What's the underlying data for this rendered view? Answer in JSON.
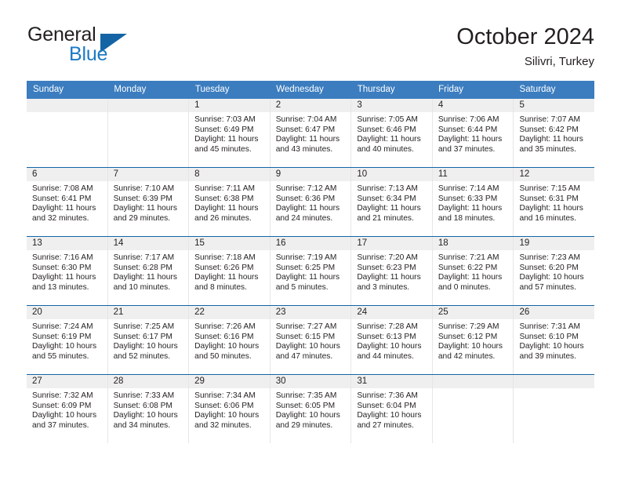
{
  "brand": {
    "name_part1": "General",
    "name_part2": "Blue",
    "logo_icon": "triangle-logo",
    "accent_color": "#1d7ac4",
    "triangle_color": "#1464a5"
  },
  "header": {
    "title": "October 2024",
    "subtitle": "Silivri, Turkey"
  },
  "calendar": {
    "header_bg": "#3b7dbf",
    "daynum_bg": "#efefef",
    "week_divider_color": "#1464a5",
    "weekdays": [
      "Sunday",
      "Monday",
      "Tuesday",
      "Wednesday",
      "Thursday",
      "Friday",
      "Saturday"
    ],
    "weeks": [
      [
        {
          "day": "",
          "sunrise": "",
          "sunset": "",
          "daylight1": "",
          "daylight2": ""
        },
        {
          "day": "",
          "sunrise": "",
          "sunset": "",
          "daylight1": "",
          "daylight2": ""
        },
        {
          "day": "1",
          "sunrise": "Sunrise: 7:03 AM",
          "sunset": "Sunset: 6:49 PM",
          "daylight1": "Daylight: 11 hours",
          "daylight2": "and 45 minutes."
        },
        {
          "day": "2",
          "sunrise": "Sunrise: 7:04 AM",
          "sunset": "Sunset: 6:47 PM",
          "daylight1": "Daylight: 11 hours",
          "daylight2": "and 43 minutes."
        },
        {
          "day": "3",
          "sunrise": "Sunrise: 7:05 AM",
          "sunset": "Sunset: 6:46 PM",
          "daylight1": "Daylight: 11 hours",
          "daylight2": "and 40 minutes."
        },
        {
          "day": "4",
          "sunrise": "Sunrise: 7:06 AM",
          "sunset": "Sunset: 6:44 PM",
          "daylight1": "Daylight: 11 hours",
          "daylight2": "and 37 minutes."
        },
        {
          "day": "5",
          "sunrise": "Sunrise: 7:07 AM",
          "sunset": "Sunset: 6:42 PM",
          "daylight1": "Daylight: 11 hours",
          "daylight2": "and 35 minutes."
        }
      ],
      [
        {
          "day": "6",
          "sunrise": "Sunrise: 7:08 AM",
          "sunset": "Sunset: 6:41 PM",
          "daylight1": "Daylight: 11 hours",
          "daylight2": "and 32 minutes."
        },
        {
          "day": "7",
          "sunrise": "Sunrise: 7:10 AM",
          "sunset": "Sunset: 6:39 PM",
          "daylight1": "Daylight: 11 hours",
          "daylight2": "and 29 minutes."
        },
        {
          "day": "8",
          "sunrise": "Sunrise: 7:11 AM",
          "sunset": "Sunset: 6:38 PM",
          "daylight1": "Daylight: 11 hours",
          "daylight2": "and 26 minutes."
        },
        {
          "day": "9",
          "sunrise": "Sunrise: 7:12 AM",
          "sunset": "Sunset: 6:36 PM",
          "daylight1": "Daylight: 11 hours",
          "daylight2": "and 24 minutes."
        },
        {
          "day": "10",
          "sunrise": "Sunrise: 7:13 AM",
          "sunset": "Sunset: 6:34 PM",
          "daylight1": "Daylight: 11 hours",
          "daylight2": "and 21 minutes."
        },
        {
          "day": "11",
          "sunrise": "Sunrise: 7:14 AM",
          "sunset": "Sunset: 6:33 PM",
          "daylight1": "Daylight: 11 hours",
          "daylight2": "and 18 minutes."
        },
        {
          "day": "12",
          "sunrise": "Sunrise: 7:15 AM",
          "sunset": "Sunset: 6:31 PM",
          "daylight1": "Daylight: 11 hours",
          "daylight2": "and 16 minutes."
        }
      ],
      [
        {
          "day": "13",
          "sunrise": "Sunrise: 7:16 AM",
          "sunset": "Sunset: 6:30 PM",
          "daylight1": "Daylight: 11 hours",
          "daylight2": "and 13 minutes."
        },
        {
          "day": "14",
          "sunrise": "Sunrise: 7:17 AM",
          "sunset": "Sunset: 6:28 PM",
          "daylight1": "Daylight: 11 hours",
          "daylight2": "and 10 minutes."
        },
        {
          "day": "15",
          "sunrise": "Sunrise: 7:18 AM",
          "sunset": "Sunset: 6:26 PM",
          "daylight1": "Daylight: 11 hours",
          "daylight2": "and 8 minutes."
        },
        {
          "day": "16",
          "sunrise": "Sunrise: 7:19 AM",
          "sunset": "Sunset: 6:25 PM",
          "daylight1": "Daylight: 11 hours",
          "daylight2": "and 5 minutes."
        },
        {
          "day": "17",
          "sunrise": "Sunrise: 7:20 AM",
          "sunset": "Sunset: 6:23 PM",
          "daylight1": "Daylight: 11 hours",
          "daylight2": "and 3 minutes."
        },
        {
          "day": "18",
          "sunrise": "Sunrise: 7:21 AM",
          "sunset": "Sunset: 6:22 PM",
          "daylight1": "Daylight: 11 hours",
          "daylight2": "and 0 minutes."
        },
        {
          "day": "19",
          "sunrise": "Sunrise: 7:23 AM",
          "sunset": "Sunset: 6:20 PM",
          "daylight1": "Daylight: 10 hours",
          "daylight2": "and 57 minutes."
        }
      ],
      [
        {
          "day": "20",
          "sunrise": "Sunrise: 7:24 AM",
          "sunset": "Sunset: 6:19 PM",
          "daylight1": "Daylight: 10 hours",
          "daylight2": "and 55 minutes."
        },
        {
          "day": "21",
          "sunrise": "Sunrise: 7:25 AM",
          "sunset": "Sunset: 6:17 PM",
          "daylight1": "Daylight: 10 hours",
          "daylight2": "and 52 minutes."
        },
        {
          "day": "22",
          "sunrise": "Sunrise: 7:26 AM",
          "sunset": "Sunset: 6:16 PM",
          "daylight1": "Daylight: 10 hours",
          "daylight2": "and 50 minutes."
        },
        {
          "day": "23",
          "sunrise": "Sunrise: 7:27 AM",
          "sunset": "Sunset: 6:15 PM",
          "daylight1": "Daylight: 10 hours",
          "daylight2": "and 47 minutes."
        },
        {
          "day": "24",
          "sunrise": "Sunrise: 7:28 AM",
          "sunset": "Sunset: 6:13 PM",
          "daylight1": "Daylight: 10 hours",
          "daylight2": "and 44 minutes."
        },
        {
          "day": "25",
          "sunrise": "Sunrise: 7:29 AM",
          "sunset": "Sunset: 6:12 PM",
          "daylight1": "Daylight: 10 hours",
          "daylight2": "and 42 minutes."
        },
        {
          "day": "26",
          "sunrise": "Sunrise: 7:31 AM",
          "sunset": "Sunset: 6:10 PM",
          "daylight1": "Daylight: 10 hours",
          "daylight2": "and 39 minutes."
        }
      ],
      [
        {
          "day": "27",
          "sunrise": "Sunrise: 7:32 AM",
          "sunset": "Sunset: 6:09 PM",
          "daylight1": "Daylight: 10 hours",
          "daylight2": "and 37 minutes."
        },
        {
          "day": "28",
          "sunrise": "Sunrise: 7:33 AM",
          "sunset": "Sunset: 6:08 PM",
          "daylight1": "Daylight: 10 hours",
          "daylight2": "and 34 minutes."
        },
        {
          "day": "29",
          "sunrise": "Sunrise: 7:34 AM",
          "sunset": "Sunset: 6:06 PM",
          "daylight1": "Daylight: 10 hours",
          "daylight2": "and 32 minutes."
        },
        {
          "day": "30",
          "sunrise": "Sunrise: 7:35 AM",
          "sunset": "Sunset: 6:05 PM",
          "daylight1": "Daylight: 10 hours",
          "daylight2": "and 29 minutes."
        },
        {
          "day": "31",
          "sunrise": "Sunrise: 7:36 AM",
          "sunset": "Sunset: 6:04 PM",
          "daylight1": "Daylight: 10 hours",
          "daylight2": "and 27 minutes."
        },
        {
          "day": "",
          "sunrise": "",
          "sunset": "",
          "daylight1": "",
          "daylight2": ""
        },
        {
          "day": "",
          "sunrise": "",
          "sunset": "",
          "daylight1": "",
          "daylight2": ""
        }
      ]
    ]
  }
}
